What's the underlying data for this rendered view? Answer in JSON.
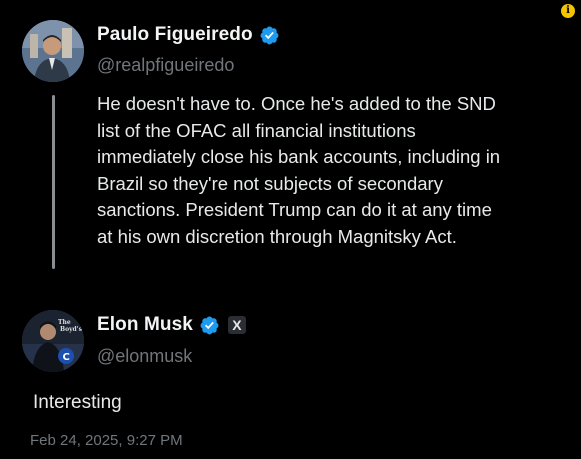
{
  "quoted_post": {
    "display_name": "Paulo Figueiredo",
    "handle": "@realpfigueiredo",
    "text": "He doesn't have to. Once he's added to the SND\nlist of the OFAC all financial institutions\nimmediately close his bank accounts, including in\nBrazil so they're not subjects of secondary\nsanctions. President Trump can do it at any time\nat his own discretion through Magnitsky Act."
  },
  "main_post": {
    "display_name": "Elon Musk",
    "handle": "@elonmusk",
    "badge_letter": "X",
    "text": "Interesting",
    "timestamp": "Feb 24, 2025, 9:27 PM"
  },
  "info_badge": "i",
  "colors": {
    "background": "#000000",
    "text": "#e7e9ea",
    "muted": "#71767b",
    "verified_blue": "#1d9bf0"
  },
  "icons": {
    "verified": "verified-checkmark-icon",
    "x_logo": "x-logo-icon",
    "info": "info-icon"
  }
}
